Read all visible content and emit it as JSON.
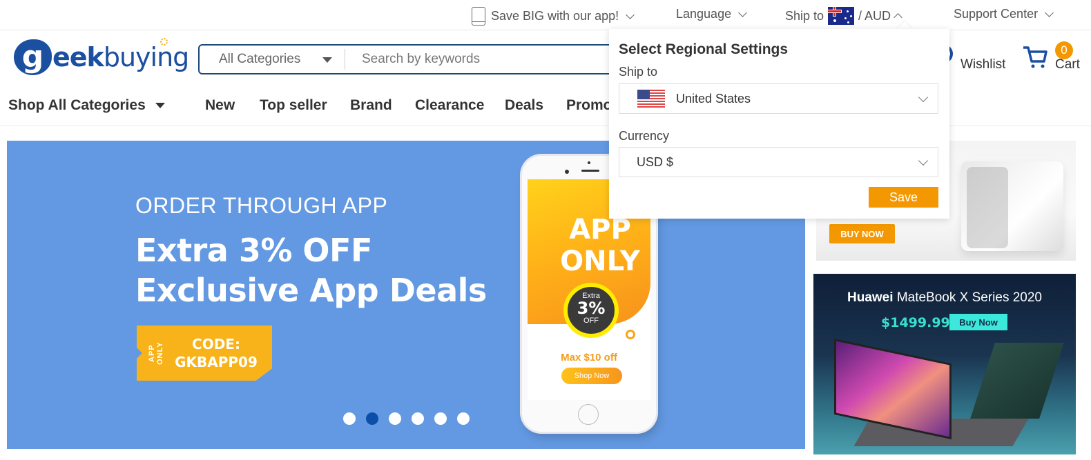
{
  "topbar": {
    "app_promo": "Save BIG with our app!",
    "language": "Language",
    "ship_to_label": "Ship to",
    "ship_to_flag": "australia-flag",
    "currency": "/ AUD",
    "support": "Support Center"
  },
  "header": {
    "logo_initial": "g",
    "logo_bold": "eek",
    "logo_regular": "buying",
    "category_select": "All Categories",
    "search_placeholder": "Search by keywords",
    "wishlist": "Wishlist",
    "cart_label": "Cart",
    "cart_count": "0"
  },
  "nav": {
    "items": [
      {
        "label": "Shop All Categories"
      },
      {
        "label": "New"
      },
      {
        "label": "Top seller"
      },
      {
        "label": "Brand"
      },
      {
        "label": "Clearance"
      },
      {
        "label": "Deals"
      },
      {
        "label": "Promo"
      }
    ]
  },
  "banner": {
    "subtitle": "ORDER THROUGH APP",
    "title_line1": "Extra 3% OFF",
    "title_line2": "Exclusive App Deals",
    "coupon_side": "APP ONLY",
    "coupon_label": "CODE:",
    "coupon_code": "GKBAPP09",
    "phone": {
      "headline_1": "APP",
      "headline_2": "ONLY",
      "badge_top": "Extra",
      "badge_value": "3%",
      "badge_bottom": "OFF",
      "max_off": "Max $10 off",
      "cta": "Shop Now"
    },
    "slides_total": 6,
    "active_slide": 2
  },
  "side_banners": [
    {
      "cta": "BUY NOW"
    },
    {
      "brand": "Huawei",
      "product": "MateBook X Series 2020",
      "price": "$1499.99",
      "cta": "Buy Now"
    }
  ],
  "regional_popup": {
    "title": "Select Regional Settings",
    "ship_to_label": "Ship to",
    "ship_to_value": "United States",
    "currency_label": "Currency",
    "currency_value": "USD $",
    "save": "Save"
  },
  "colors": {
    "brand_blue": "#1b4fa0",
    "accent_orange": "#f39800",
    "banner_blue": "#6399e2",
    "active_dot": "#0d4fa8"
  }
}
